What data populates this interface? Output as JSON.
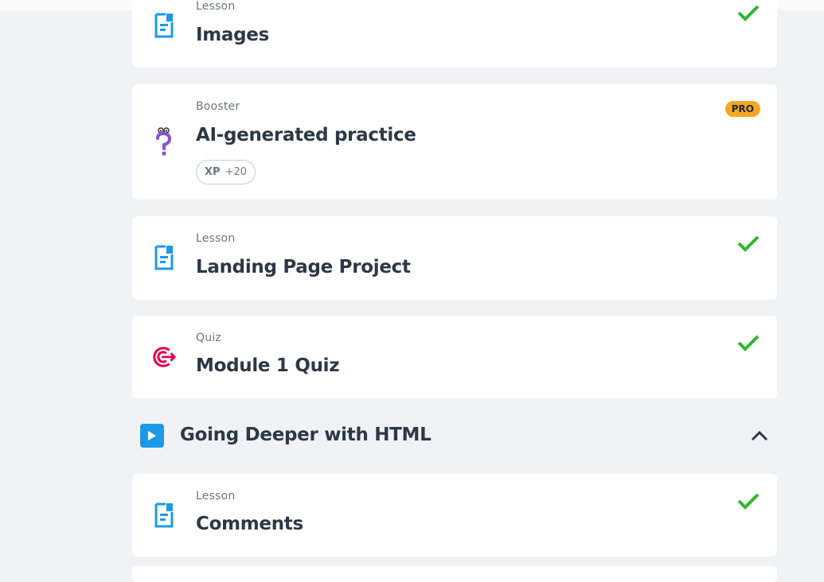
{
  "colors": {
    "background": "#f0f2f5",
    "card": "#ffffff",
    "lesson_icon": "#1c9ae8",
    "check": "#2eb82e",
    "pro_badge": "#f5a623",
    "quiz_icon": "#e5004f",
    "booster_icon": "#8b4fd8"
  },
  "cards": [
    {
      "kind": "Lesson",
      "title": "Images",
      "icon": "lesson-document-icon",
      "completed": true
    },
    {
      "kind": "Booster",
      "title": "AI-generated practice",
      "icon": "booster-question-icon",
      "badge": "PRO",
      "xp_label": "XP",
      "xp_value": "+20"
    },
    {
      "kind": "Lesson",
      "title": "Landing Page Project",
      "icon": "lesson-document-icon",
      "completed": true
    },
    {
      "kind": "Quiz",
      "title": "Module 1 Quiz",
      "icon": "quiz-target-icon",
      "completed": true
    }
  ],
  "section": {
    "title": "Going Deeper with HTML",
    "icon": "play-icon",
    "expanded": true,
    "cards": [
      {
        "kind": "Lesson",
        "title": "Comments",
        "icon": "lesson-document-icon",
        "completed": true
      }
    ]
  }
}
